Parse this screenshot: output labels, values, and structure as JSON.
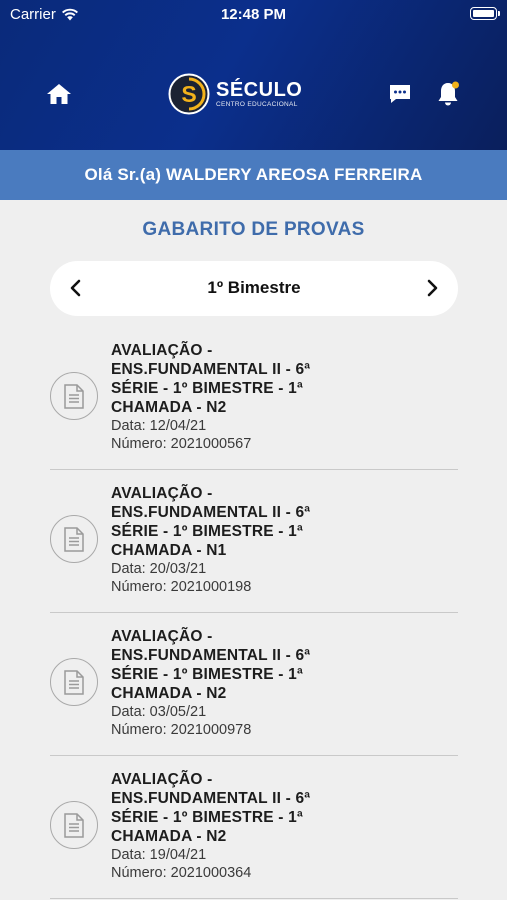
{
  "status_bar": {
    "carrier": "Carrier",
    "time": "12:48 PM"
  },
  "header": {
    "logo_title": "SÉCULO",
    "logo_subtitle": "CENTRO EDUCACIONAL",
    "icons": [
      "home-icon",
      "message-icon",
      "bell-icon"
    ]
  },
  "greeting": "Olá Sr.(a) WALDERY AREOSA FERREIRA",
  "page_title": "GABARITO DE PROVAS",
  "period": {
    "label": "1º Bimestre"
  },
  "exams": [
    {
      "title_line1": "AVALIAÇÃO -",
      "title_line2": "ENS.FUNDAMENTAL II - 6ª",
      "title_line3": "SÉRIE - 1º BIMESTRE - 1ª",
      "title_line4": "CHAMADA - N2",
      "date": "Data: 12/04/21",
      "number": "Número: 2021000567"
    },
    {
      "title_line1": "AVALIAÇÃO -",
      "title_line2": "ENS.FUNDAMENTAL II - 6ª",
      "title_line3": "SÉRIE - 1º BIMESTRE - 1ª",
      "title_line4": "CHAMADA - N1",
      "date": "Data: 20/03/21",
      "number": "Número: 2021000198"
    },
    {
      "title_line1": "AVALIAÇÃO -",
      "title_line2": "ENS.FUNDAMENTAL II - 6ª",
      "title_line3": "SÉRIE - 1º BIMESTRE - 1ª",
      "title_line4": "CHAMADA - N2",
      "date": "Data: 03/05/21",
      "number": "Número: 2021000978"
    },
    {
      "title_line1": "AVALIAÇÃO -",
      "title_line2": "ENS.FUNDAMENTAL II - 6ª",
      "title_line3": "SÉRIE - 1º BIMESTRE - 1ª",
      "title_line4": "CHAMADA - N2",
      "date": "Data: 19/04/21",
      "number": "Número: 2021000364"
    }
  ],
  "colors": {
    "header": "#0b2f8c",
    "greeting_bar": "#4a7bbf",
    "title": "#3f6cab",
    "logo_accent": "#f2b21b"
  }
}
